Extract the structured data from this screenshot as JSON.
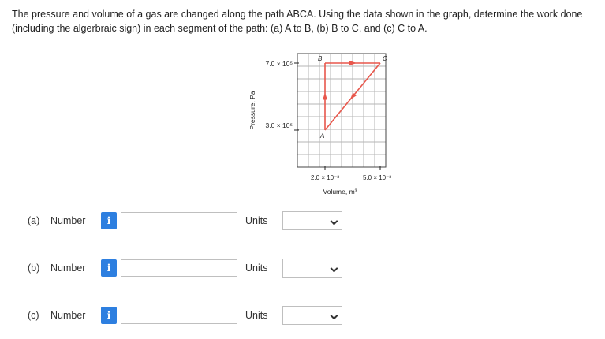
{
  "question": {
    "text": "The pressure and volume of a gas are changed along the path ABCA. Using the data shown in the graph, determine the work done (including the algerbraic sign) in each segment of the path: (a) A to B, (b) B to C, and (c) C to A."
  },
  "chart_data": {
    "type": "line",
    "xlabel": "Volume, m³",
    "ylabel": "Pressure, Pa",
    "x_tick_labels": [
      "2.0 × 10⁻³",
      "5.0 × 10⁻³"
    ],
    "y_tick_labels": [
      "7.0 × 10⁵",
      "3.0 × 10⁵"
    ],
    "series": [
      {
        "points": [
          {
            "label": "A",
            "x": 0.002,
            "y": 300000
          },
          {
            "label": "B",
            "x": 0.002,
            "y": 700000
          },
          {
            "label": "C",
            "x": 0.005,
            "y": 700000
          },
          {
            "label": "A",
            "x": 0.002,
            "y": 300000
          }
        ]
      }
    ],
    "line_color": "#e8574c",
    "grid": true
  },
  "rows": [
    {
      "part": "(a)",
      "number_label": "Number",
      "info": "i",
      "value": "",
      "units_label": "Units",
      "units_value": ""
    },
    {
      "part": "(b)",
      "number_label": "Number",
      "info": "i",
      "value": "",
      "units_label": "Units",
      "units_value": ""
    },
    {
      "part": "(c)",
      "number_label": "Number",
      "info": "i",
      "value": "",
      "units_label": "Units",
      "units_value": ""
    }
  ],
  "colors": {
    "info_button": "#2d7fe0",
    "path": "#e8574c"
  }
}
